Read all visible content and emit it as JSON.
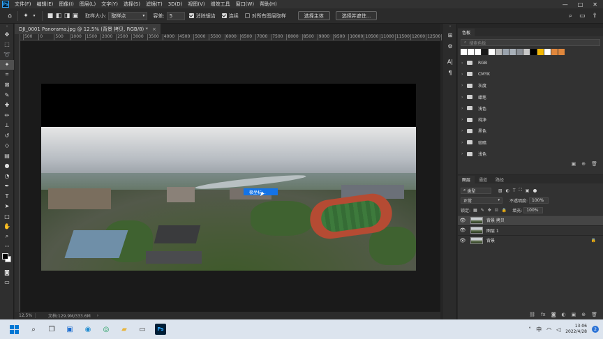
{
  "menubar": {
    "logo": "Ps",
    "items": [
      "文件(F)",
      "编辑(E)",
      "图像(I)",
      "图层(L)",
      "文字(Y)",
      "选择(S)",
      "滤镜(T)",
      "3D(D)",
      "视图(V)",
      "增效工具",
      "窗口(W)",
      "帮助(H)"
    ],
    "window_controls": [
      "—",
      "□",
      "✕"
    ]
  },
  "options": {
    "sample_size_label": "取样大小:",
    "sample_size_value": "取样点",
    "tolerance_label": "容差:",
    "tolerance_value": "5",
    "antialias_label": "消除锯齿",
    "contiguous_label": "连续",
    "all_layers_label": "对所有图层取样",
    "select_subject": "选择主体",
    "select_and_mask": "选择并遮住..."
  },
  "document": {
    "tab_title": "DJI_0001 Panorama.jpg @ 12.5% (背景 拷贝, RGB/8) *",
    "close": "×",
    "ruler_ticks": [
      "500",
      "0",
      "500",
      "1000",
      "1500",
      "2000",
      "2500",
      "3000",
      "3500",
      "4000",
      "4500",
      "5000",
      "5500",
      "6000",
      "6500",
      "7000",
      "7500",
      "8000",
      "8500",
      "9000",
      "9500",
      "10000",
      "10500",
      "11000",
      "11500",
      "12000",
      "12500",
      "13000"
    ],
    "popup_label": "极坐标...",
    "status_zoom": "12.5%",
    "status_doc": "文档:129.9M/333.6M",
    "status_arrow": "›"
  },
  "panels": {
    "swatches": {
      "tab": "色板",
      "search_placeholder": "搜索色板",
      "colors": [
        "#ffffff",
        "#ffffff",
        "#ffffff",
        "#1a1a1a",
        "#ffffff",
        "#b5b5b5",
        "#9aa3ad",
        "#a8b0b8",
        "#8a8f96",
        "#c8c8c8",
        "#000000",
        "#f2b705",
        "#ffffff",
        "#e0873c",
        "#e0873c"
      ],
      "groups": [
        "RGB",
        "CMYK",
        "灰度",
        "蜡笔",
        "浅色",
        "纯净",
        "黑色",
        "较暗",
        "浅色"
      ]
    },
    "layers": {
      "tabs": [
        "图层",
        "通道",
        "路径"
      ],
      "filter_label": "类型",
      "blend_mode": "正常",
      "opacity_label": "不透明度:",
      "opacity_value": "100%",
      "lock_label": "锁定:",
      "fill_label": "填充:",
      "fill_value": "100%",
      "items": [
        {
          "name": "背景 拷贝",
          "selected": true,
          "locked": false
        },
        {
          "name": "图层 1",
          "selected": false,
          "locked": false
        },
        {
          "name": "背景",
          "selected": false,
          "locked": true
        }
      ]
    }
  },
  "taskbar": {
    "time": "13:06",
    "date": "2022/4/28",
    "lang": "中",
    "notif": "2"
  }
}
